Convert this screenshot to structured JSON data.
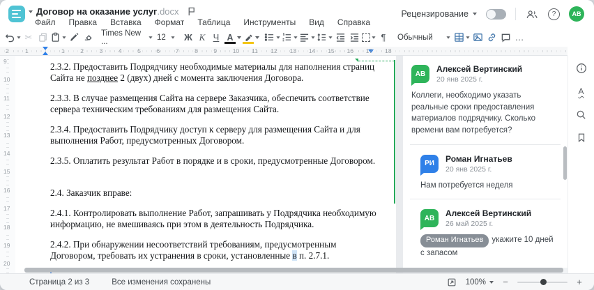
{
  "header": {
    "title": "Договор на оказание услуг",
    "title_ext": ".docx",
    "menu_items": [
      "Файл",
      "Правка",
      "Вставка",
      "Формат",
      "Таблица",
      "Инструменты",
      "Вид",
      "Справка"
    ],
    "review_label": "Рецензирование",
    "help_label": "?",
    "avatar_initials": "АВ"
  },
  "toolbar": {
    "font_family": "Times New ...",
    "font_size": "12",
    "bold_label": "Ж",
    "italic_label": "К",
    "underline_label": "Ч",
    "font_color_label": "А",
    "pilcrow_label": "¶",
    "style_name": "Обычный",
    "more_label": "…"
  },
  "ruler": {
    "h_left": [
      "2",
      "1"
    ],
    "h_main": [
      "1",
      "2",
      "3",
      "4",
      "5",
      "6",
      "7",
      "8",
      "9",
      "10",
      "11",
      "12",
      "13",
      "14",
      "15",
      "16",
      "17",
      "18"
    ],
    "v_numbers": [
      "9",
      "10",
      "11",
      "12",
      "13",
      "14",
      "15",
      "16",
      "17",
      "18",
      "19",
      "20"
    ]
  },
  "document": {
    "p1": {
      "a": "2.3.2. Предоставить Подрядчику необходимые материалы для наполнения страниц Сайта не ",
      "anchor": "позднее",
      "b": " 2 (двух) дней с момента заключения Договора."
    },
    "p2": "2.3.3. В случае размещения Сайта на сервере Заказчика, обеспечить соответствие сервера техническим требованиям для размещения Сайта.",
    "p3": "2.3.4. Предоставить Подрядчику доступ к серверу для размещения Сайта и для выполнения Работ, предусмотренных Договором.",
    "p4": "2.3.5. Оплатить результат Работ в порядке и в сроки, предусмотренные Договором.",
    "p5": "2.4. Заказчик вправе:",
    "p6": "2.4.1. Контролировать выполнение Работ, запрашивать у Подрядчика необходимую информацию, не вмешиваясь при этом в деятельность Подрядчика.",
    "p7": {
      "a": "2.4.2. При обнаружении несоответствий требованиям, предусмотренным Договором, требовать их устранения в сроки, установленные ",
      "hl": "в",
      "b": " п. 2.7.1."
    }
  },
  "comments": [
    {
      "initials": "АВ",
      "color": "#2eb45a",
      "name": "Алексей Вертинский",
      "date": "20 янв 2025 г.",
      "text": "Коллеги, необходимо указать реальные сроки предоставления материалов подрядчику. Сколько времени вам потребуется?"
    },
    {
      "initials": "РИ",
      "color": "#2f80e8",
      "name": "Роман Игнатьев",
      "date": "20 янв 2025 г.",
      "text": "Нам потребуется неделя"
    },
    {
      "initials": "АВ",
      "color": "#2eb45a",
      "name": "Алексей Вертинский",
      "date": "26 май 2025 г.",
      "mention": "Роман Игнатьев",
      "text": "укажите 10 дней с запасом"
    }
  ],
  "status_bar": {
    "page_label": "Страница 2 из 3",
    "saved_label": "Все изменения сохранены",
    "zoom_value": "100%",
    "zoom_out": "−",
    "zoom_in": "+"
  },
  "colors": {
    "accent_teal": "#4fc3d4",
    "icon_blue": "#4679ad",
    "comment_green": "#27a95c"
  }
}
